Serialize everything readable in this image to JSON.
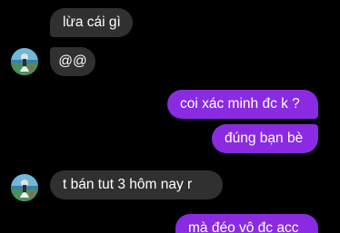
{
  "colors": {
    "background": "#000000",
    "incoming_bubble": "#303030",
    "outgoing_bubble": "#8a2be2",
    "text": "#ffffff"
  },
  "messages": [
    {
      "id": 1,
      "direction": "incoming",
      "text": "lừa cái gì",
      "avatar": false
    },
    {
      "id": 2,
      "direction": "incoming",
      "text": "@@",
      "avatar": true
    },
    {
      "id": 3,
      "direction": "outgoing",
      "text": "coi xác minh đc k ?"
    },
    {
      "id": 4,
      "direction": "outgoing",
      "text": "đúng bạn bè"
    },
    {
      "id": 5,
      "direction": "incoming",
      "text": "t bán tut 3 hôm nay r",
      "avatar": true
    },
    {
      "id": 6,
      "direction": "outgoing",
      "text": "mà đéo vô đc acc"
    }
  ]
}
